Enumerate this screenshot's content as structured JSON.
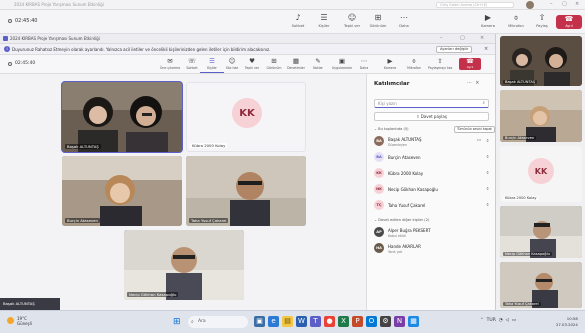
{
  "outer_window": {
    "title": "2024 KIRBAS Proje Yarışması Sunum Etkinliği",
    "search_placeholder": "Giriş Galeri Arama (Ctrl+E)",
    "timer": "02:45:40",
    "toolbar": [
      {
        "icon": "♪",
        "label": "Sohbet"
      },
      {
        "icon": "☰",
        "label": "Kişiler"
      },
      {
        "icon": "☺",
        "label": "Tepki ver"
      },
      {
        "icon": "⊞",
        "label": "Görünüm"
      },
      {
        "icon": "⋯",
        "label": "Daha"
      },
      {
        "icon": "▶",
        "label": "Kamera"
      },
      {
        "icon": "⌽",
        "label": "Mikrofon"
      },
      {
        "icon": "⇧",
        "label": "Paylaş"
      }
    ],
    "leave_label": "Ayrıl",
    "strip": [
      {
        "name": "Başak ALTUNTAŞ"
      },
      {
        "name": "Burçin Ataseven"
      },
      {
        "name": "Kübra 2000 Kolay",
        "initials": "KK"
      },
      {
        "name": "Necip Gökhan Kasapoğlu"
      },
      {
        "name": "Taha Yusuf Çakarel"
      }
    ]
  },
  "inner_window": {
    "title": "2024 KIRBAS Proje Yarışması Sunum Etkinliği",
    "notice": "Duyurunuz Rahatsız Etmeyin olarak ayarlandı. Yalnızca acil iletiler ve öncelikli kişilerinizden gelen iletiler için bildirim alacaksınız.",
    "notice_action": "Ayarları değiştir",
    "timer": "02:45:40",
    "toolbar": [
      {
        "icon": "✉",
        "label": "Öne çıkarma",
        "active": false
      },
      {
        "icon": "☏",
        "label": "Sohbet",
        "active": false
      },
      {
        "icon": "☰",
        "label": "Kişiler",
        "active": true
      },
      {
        "icon": "☺",
        "label": "Söz iste",
        "active": false
      },
      {
        "icon": "♥",
        "label": "Tepki ver",
        "active": false
      },
      {
        "icon": "⊞",
        "label": "Görünüm",
        "active": false
      },
      {
        "icon": "▦",
        "label": "Denetimler",
        "active": false
      },
      {
        "icon": "✎",
        "label": "Notlar",
        "active": false
      },
      {
        "icon": "▣",
        "label": "Uygulamalar",
        "active": false
      },
      {
        "icon": "⋯",
        "label": "Daha",
        "active": false
      },
      {
        "icon": "▶",
        "label": "Kamera",
        "active": false
      },
      {
        "icon": "⌽",
        "label": "Mikrofon",
        "active": false
      },
      {
        "icon": "⇧",
        "label": "Paylaşmayı kes",
        "active": false
      }
    ],
    "leave_label": "Ayrıl",
    "tiles": [
      {
        "name": "Başak ALTUNTAŞ",
        "kind": "video"
      },
      {
        "name": "Kübra 2000 Kolay",
        "kind": "avatar",
        "initials": "KK"
      },
      {
        "name": "Burçin Ataseven",
        "kind": "video"
      },
      {
        "name": "Taha Yusuf Çakarel",
        "kind": "video"
      },
      {
        "name": "Necip Gökhan Kasapoğlu",
        "kind": "video"
      }
    ],
    "share_label": "Başak ALTUNTAŞ"
  },
  "panel": {
    "title": "Katılımcılar",
    "search_placeholder": "Kişi yazın",
    "share_button": "Davet paylaş",
    "in_meeting_label": "Bu toplantıda (5)",
    "mute_all": "Tümünün sesini kapat",
    "members": [
      {
        "initials": "BA",
        "name": "Başak ALTUNTAŞ",
        "status": "Düzenleyen",
        "color": "#8b6b5a"
      },
      {
        "initials": "BA",
        "name": "Burçin Ataseven",
        "status": "",
        "color": "#e6e0f5"
      },
      {
        "initials": "KK",
        "name": "Kübra 2000 Kolay",
        "status": "",
        "color": "#f6d1d6"
      },
      {
        "initials": "NK",
        "name": "Necip Gökhan Kasapoğlu",
        "status": "",
        "color": "#f6d1d6"
      },
      {
        "initials": "TÇ",
        "name": "Taha Yusuf Çakarel",
        "status": "",
        "color": "#f6d1d6"
      }
    ],
    "others_label": "Davet edilen diğer kişiler (2)",
    "others": [
      {
        "initials": "AP",
        "name": "Alper Buğra PEKSERT",
        "status": "Kabul etildi",
        "color": "#4a4a4a"
      },
      {
        "initials": "HA",
        "name": "Hande AKARLAR",
        "status": "Yanıt yok",
        "color": "#6a5a4a"
      }
    ]
  },
  "taskbar": {
    "weather_temp": "19°C",
    "weather_desc": "Güneşli",
    "search_label": "Ara",
    "tray_lang": "TUR",
    "time": "10:58",
    "date": "27.03.2024"
  }
}
